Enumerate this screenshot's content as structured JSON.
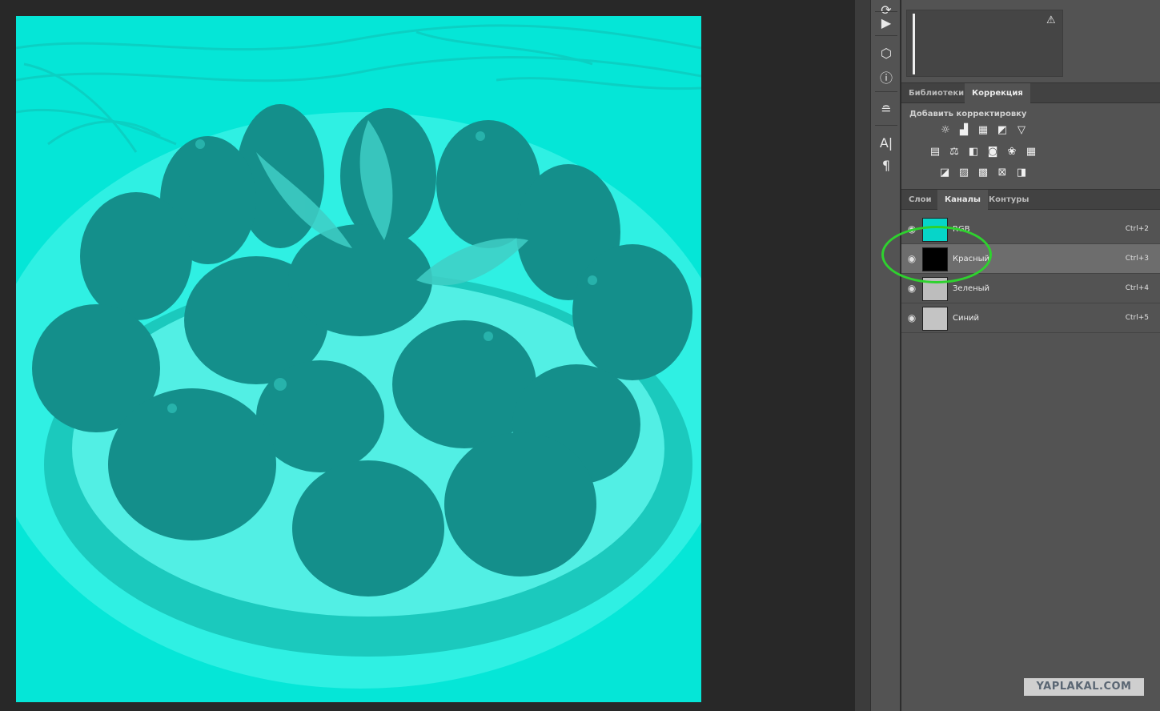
{
  "panels": {
    "top_tabs": [
      {
        "label": "Библиотеки",
        "active": false
      },
      {
        "label": "Коррекция",
        "active": true
      }
    ],
    "adjustments_title": "Добавить корректировку",
    "adjustment_icons": [
      [
        "brightness-icon",
        "levels-icon",
        "curves-icon",
        "exposure-icon",
        "vibrance-icon"
      ],
      [
        "hue-saturation-icon",
        "color-balance-icon",
        "black-white-icon",
        "photo-filter-icon",
        "channel-mixer-icon",
        "color-lookup-icon"
      ],
      [
        "invert-icon",
        "posterize-icon",
        "threshold-icon",
        "selective-color-icon",
        "gradient-map-icon"
      ]
    ],
    "bottom_tabs": [
      {
        "label": "Слои",
        "active": false
      },
      {
        "label": "Каналы",
        "active": true
      },
      {
        "label": "Контуры",
        "active": false
      }
    ],
    "channels": [
      {
        "name": "RGB",
        "shortcut": "Ctrl+2",
        "selected": false,
        "thumb": "cyan"
      },
      {
        "name": "Красный",
        "shortcut": "Ctrl+3",
        "selected": true,
        "thumb": "black"
      },
      {
        "name": "Зеленый",
        "shortcut": "Ctrl+4",
        "selected": false,
        "thumb": "gray"
      },
      {
        "name": "Синий",
        "shortcut": "Ctrl+5",
        "selected": false,
        "thumb": "gray"
      }
    ]
  },
  "colors": {
    "canvas_fill": "#05e6d7",
    "highlight_ring": "#2ed22e",
    "panel_bg": "#535353"
  },
  "watermark": "YAPLAKAL.COM"
}
